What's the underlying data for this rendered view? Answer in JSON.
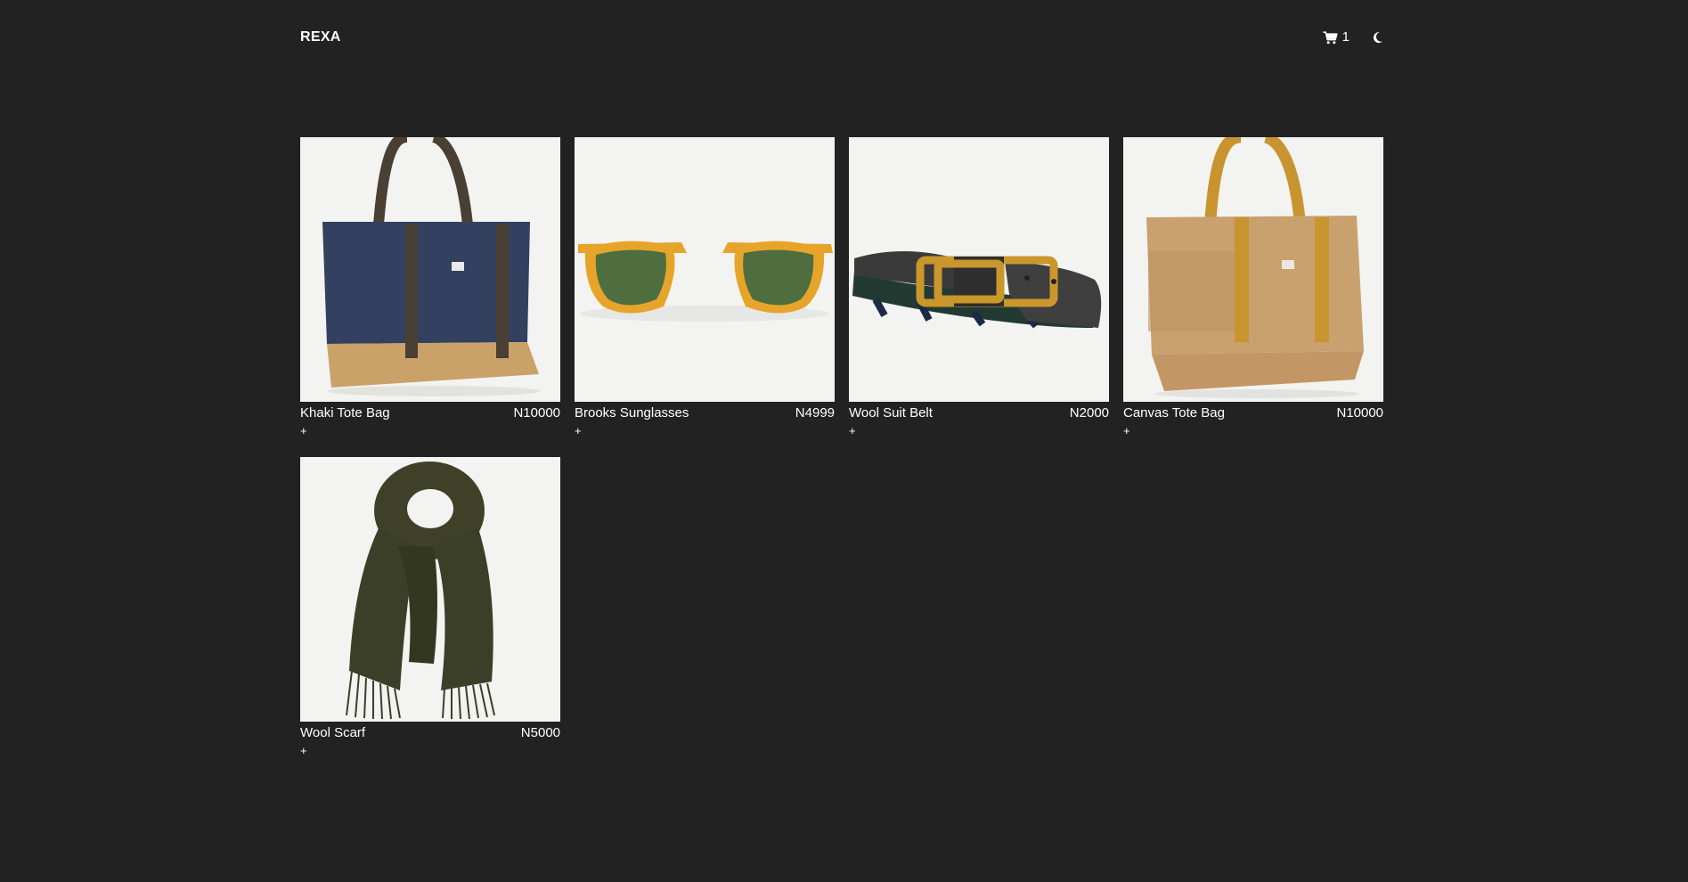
{
  "header": {
    "brand": "REXA",
    "cart_icon": "shopping-cart-icon",
    "cart_count": "1",
    "theme_icon": "crescent-moon-icon"
  },
  "products": [
    {
      "name": "Khaki Tote Bag",
      "price": "N10000",
      "add_label": "+",
      "image": "navy-tote-bag"
    },
    {
      "name": "Brooks Sunglasses",
      "price": "N4999",
      "add_label": "+",
      "image": "amber-sunglasses"
    },
    {
      "name": "Wool Suit Belt",
      "price": "N2000",
      "add_label": "+",
      "image": "leather-belt"
    },
    {
      "name": "Canvas Tote Bag",
      "price": "N10000",
      "add_label": "+",
      "image": "tan-tote-bag"
    },
    {
      "name": "Wool Scarf",
      "price": "N5000",
      "add_label": "+",
      "image": "olive-wool-scarf"
    }
  ],
  "colors": {
    "background": "#222222",
    "text": "#ffffff",
    "image_background": "#f3f3f1"
  }
}
